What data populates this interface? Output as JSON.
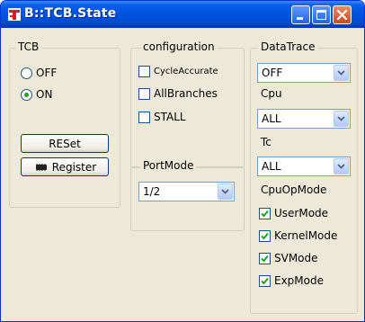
{
  "window": {
    "title": "B::TCB.State"
  },
  "tcb": {
    "legend": "TCB",
    "options": [
      {
        "label": "OFF",
        "selected": false
      },
      {
        "label": "ON",
        "selected": true
      }
    ],
    "reset_label": "RESet",
    "register_label": "Register"
  },
  "configuration": {
    "legend": "configuration",
    "items": [
      {
        "label": "CycleAccurate",
        "checked": false
      },
      {
        "label": "AllBranches",
        "checked": false
      },
      {
        "label": "STALL",
        "checked": false
      }
    ]
  },
  "portmode": {
    "legend": "PortMode",
    "value": "1/2"
  },
  "datatrace": {
    "legend": "DataTrace",
    "value": "OFF"
  },
  "cpu": {
    "legend": "Cpu",
    "value": "ALL"
  },
  "tc": {
    "legend": "Tc",
    "value": "ALL"
  },
  "cpuopmode": {
    "legend": "CpuOpMode",
    "items": [
      {
        "label": "UserMode",
        "checked": true
      },
      {
        "label": "KernelMode",
        "checked": true
      },
      {
        "label": "SVMode",
        "checked": true
      },
      {
        "label": "ExpMode",
        "checked": true
      }
    ]
  },
  "colors": {
    "titlebar": "#0054e3",
    "check": "#21a121",
    "face": "#ece9d8"
  }
}
